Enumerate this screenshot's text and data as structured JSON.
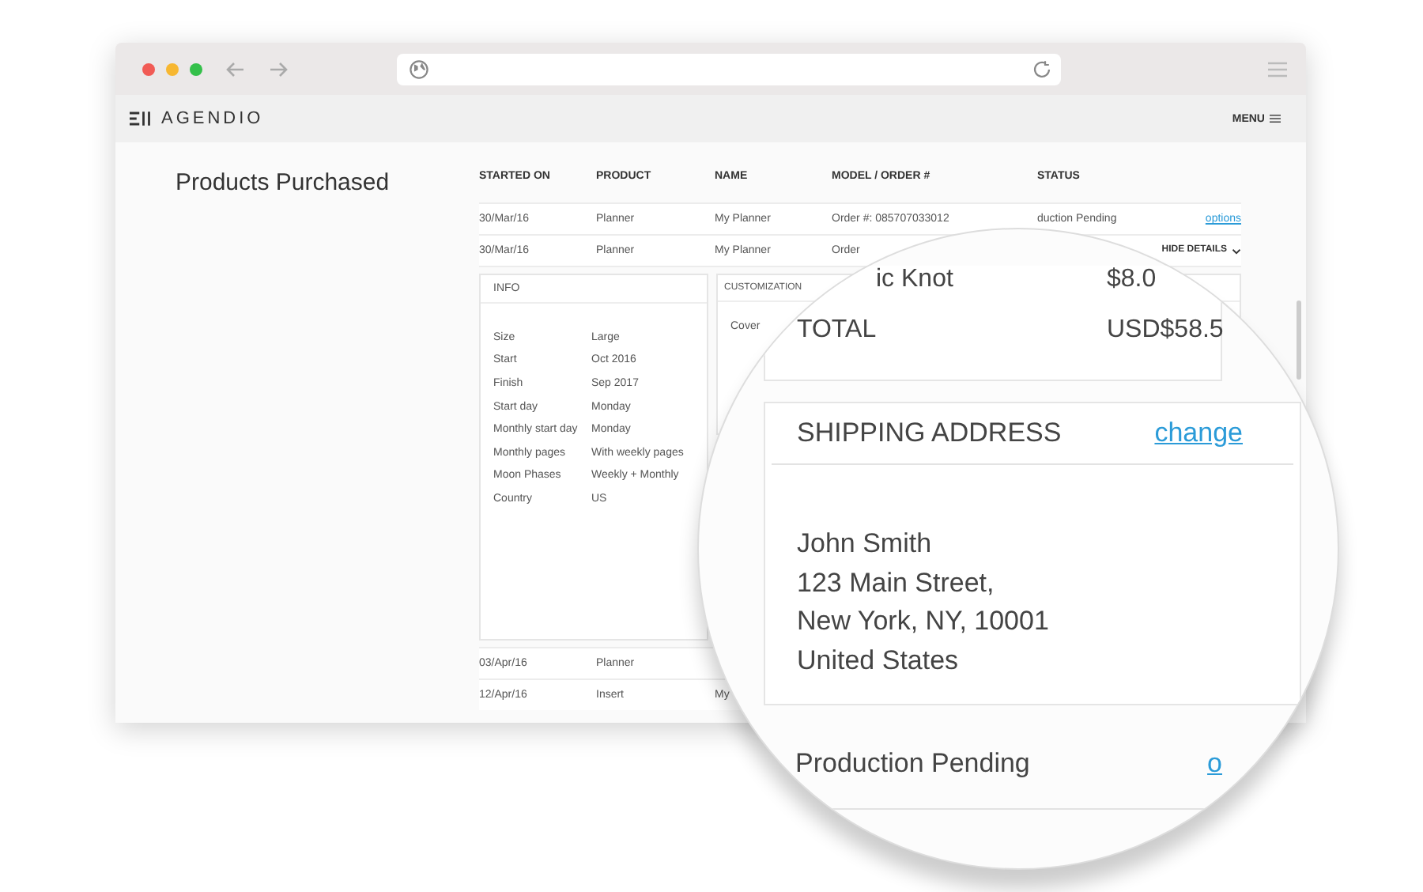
{
  "app_header": {
    "logo": "AGENDIO",
    "menu": "MENU"
  },
  "page_title": "Products Purchased",
  "table": {
    "columns": [
      "STARTED ON",
      "PRODUCT",
      "NAME",
      "MODEL / ORDER #",
      "STATUS"
    ],
    "rows": [
      {
        "started_on": "30/Mar/16",
        "product": "Planner",
        "name": "My Planner",
        "order": "Order #: 085707033012",
        "status": "duction Pending",
        "action": "options"
      },
      {
        "started_on": "30/Mar/16",
        "product": "Planner",
        "name": "My Planner",
        "order": "Order",
        "toggle": "HIDE DETAILS",
        "details": {
          "info": {
            "title": "INFO",
            "fields": [
              {
                "label": "Size",
                "value": "Large"
              },
              {
                "label": "Start",
                "value": "Oct 2016"
              },
              {
                "label": "Finish",
                "value": "Sep 2017"
              },
              {
                "label": "Start day",
                "value": "Monday"
              },
              {
                "label": "Monthly start day",
                "value": "Monday"
              },
              {
                "label": "Monthly pages",
                "value": "With weekly pages"
              },
              {
                "label": "Moon Phases",
                "value": "Weekly + Monthly"
              },
              {
                "label": "Country",
                "value": "US"
              }
            ]
          },
          "customization": {
            "title": "CUSTOMIZATION",
            "fields": [
              {
                "label": "Cover"
              }
            ]
          }
        }
      },
      {
        "started_on": "03/Apr/16",
        "product": "Planner"
      },
      {
        "started_on": "12/Apr/16",
        "product": "Insert",
        "name": "My"
      }
    ]
  },
  "magnifier": {
    "lines": [
      {
        "label": "ic Knot",
        "amount": "$8.0"
      },
      {
        "label": "TOTAL",
        "amount": "USD$58.5"
      }
    ],
    "shipping": {
      "title": "SHIPPING ADDRESS",
      "action": "change",
      "address": [
        "John Smith",
        "123 Main Street,",
        "New York, NY, 10001",
        "United States"
      ]
    },
    "status": "Production Pending",
    "action": "o"
  }
}
